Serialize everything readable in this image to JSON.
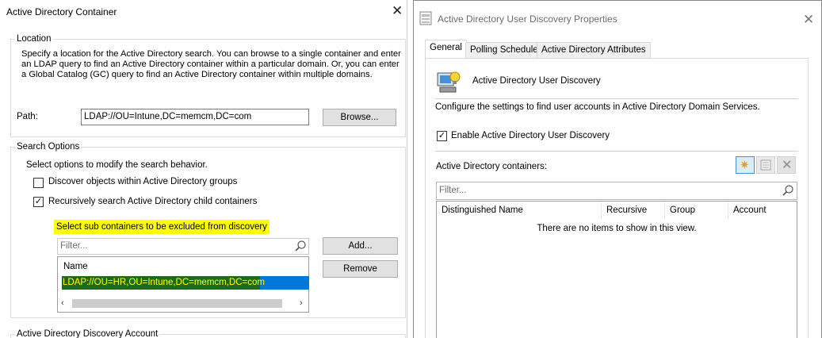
{
  "left_dialog": {
    "title": "Active Directory Container",
    "location": {
      "group_title": "Location",
      "description": "Specify a location for the Active Directory search. You can browse to a single container and enter an LDAP query to find an Active Directory container within a particular domain. Or, you can enter a Global Catalog (GC) query to find an Active Directory container within multiple domains.",
      "path_label": "Path:",
      "path_value": "LDAP://OU=Intune,DC=memcm,DC=com",
      "browse_label": "Browse..."
    },
    "search_options": {
      "group_title": "Search Options",
      "description": "Select options to modify the search behavior.",
      "discover_groups_label": "Discover objects within Active Directory groups",
      "recursive_label": "Recursively search Active Directory child containers",
      "exclude_label": "Select sub containers to be excluded from discovery",
      "filter_placeholder": "Filter...",
      "add_label": "Add...",
      "remove_label": "Remove",
      "column_name": "Name",
      "rows": [
        "LDAP://OU=HR,OU=Intune,DC=memcm,DC=com"
      ]
    },
    "account_group_title": "Active Directory Discovery Account"
  },
  "right_dialog": {
    "title": "Active Directory User Discovery Properties",
    "tabs": [
      "General",
      "Polling Schedule",
      "Active Directory Attributes"
    ],
    "header_title": "Active Directory User Discovery",
    "description": "Configure the settings to find user accounts in Active Directory Domain Services.",
    "enable_label": "Enable Active Directory User Discovery",
    "containers_label": "Active Directory containers:",
    "filter_placeholder": "Filter...",
    "columns": [
      "Distinguished Name",
      "Recursive",
      "Group",
      "Account"
    ],
    "empty_message": "There are no items to show in this view."
  },
  "colors": {
    "highlight": "#ffff00",
    "selection": "#0078d7",
    "selection_text": "#ffff00"
  }
}
